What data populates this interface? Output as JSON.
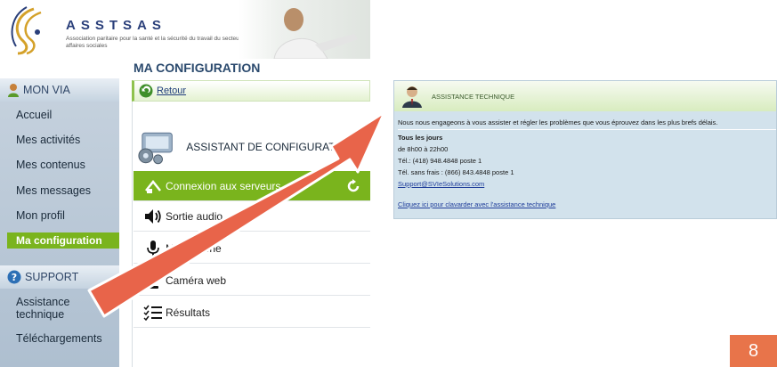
{
  "header": {
    "brand": "ASSTSAS",
    "tagline": "Association paritaire pour la santé et la sécurité du travail du secteur affaires sociales"
  },
  "sidebar": {
    "section_via": "MON VIA",
    "items": [
      "Accueil",
      "Mes activités",
      "Mes contenus",
      "Mes messages",
      "Mon profil"
    ],
    "active_item": "Ma configuration",
    "section_support": "SUPPORT",
    "support_items": [
      "Assistance\ntechnique",
      "Téléchargements"
    ]
  },
  "main": {
    "page_title": "MA CONFIGURATION",
    "back_label": "Retour",
    "wizard_title": "ASSISTANT DE CONFIGURATION",
    "steps": [
      "Connexion aux serveurs",
      "Sortie audio",
      "Microphone",
      "Caméra web",
      "Résultats"
    ]
  },
  "assistance": {
    "title": "ASSISTANCE TECHNIQUE",
    "intro": "Nous nous engageons à vous assister et régler les problèmes que vous éprouvez dans les plus brefs délais.",
    "days": "Tous les jours",
    "hours": "de 8h00 à 22h00",
    "phone": "Tél.: (418) 948.4848 poste 1",
    "tollfree": "Tél. sans frais : (866) 843.4848 poste 1",
    "email": "Support@SVIeSolutions.com",
    "chat_link": "Cliquez ici pour clavarder avec l'assistance technique"
  },
  "slide_number": "8",
  "colors": {
    "accent_green": "#7ab41d",
    "arrow": "#e8644a",
    "sidebar": "#b6c6d6",
    "panel": "#d2e2ec"
  }
}
